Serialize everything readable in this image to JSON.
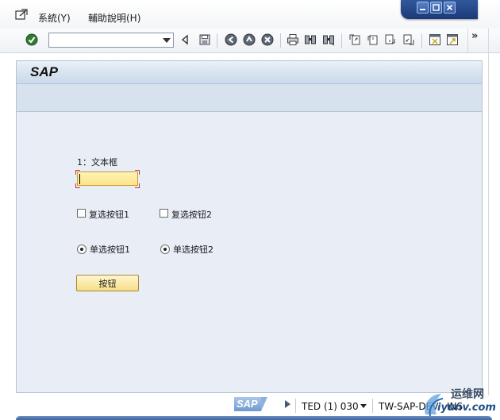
{
  "menu": {
    "items": [
      {
        "label": "系統(Y)"
      },
      {
        "label": "輔助說明(H)"
      }
    ]
  },
  "window_controls": [
    "minimize-icon",
    "maximize-icon",
    "close-icon"
  ],
  "toolbar": {
    "command_field": {
      "value": "",
      "placeholder": ""
    },
    "more_label": "»",
    "icons": [
      "enter-icon",
      "back-nav-icon",
      "save-icon",
      "back-icon",
      "exit-icon",
      "cancel-icon",
      "print-icon",
      "find-icon",
      "find-next-icon",
      "first-page-icon",
      "previous-page-icon",
      "next-page-icon",
      "last-page-icon",
      "create-session-icon",
      "shortcut-icon"
    ]
  },
  "title": {
    "text": "SAP"
  },
  "form": {
    "text_field_label": "1：文本框",
    "text_field_value": "",
    "checkbox1_label": "复选按钮1",
    "checkbox2_label": "复选按钮2",
    "radio1_label": "单选按钮1",
    "radio2_label": "单选按钮2",
    "button_label": "按钮"
  },
  "status": {
    "logo_text": "SAP",
    "system": "TED (1) 030",
    "server": "TW-SAP-DEV",
    "mode": "INS"
  },
  "watermark": {
    "cn": "运维网",
    "en": "iyunv.com"
  },
  "colors": {
    "frame_blue": "#1b3a78",
    "input_yellow": "#ffe48a",
    "main_bg": "#e9eef6",
    "title_bg": "#c9d8ea"
  }
}
